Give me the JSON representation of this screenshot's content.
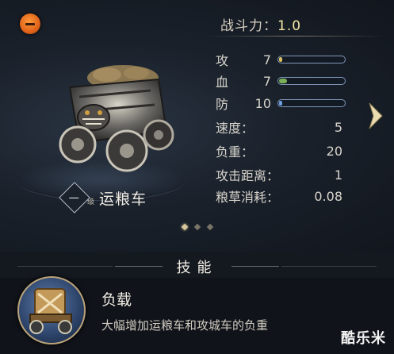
{
  "header": {
    "power_label": "战斗力：",
    "power_value": "1.0"
  },
  "unit": {
    "rank": "一",
    "level_tag": "级",
    "name": "运粮车"
  },
  "stats": [
    {
      "label": "攻",
      "value": "7",
      "bar_fraction": 0.03,
      "bar_color": "#d8c060"
    },
    {
      "label": "血",
      "value": "7",
      "bar_fraction": 0.12,
      "bar_color": "#7bb05a"
    },
    {
      "label": "防",
      "value": "10",
      "bar_fraction": 0.05,
      "bar_color": "#6aa0e0"
    }
  ],
  "attributes": [
    {
      "label": "速度：",
      "value": "5"
    },
    {
      "label": "负重：",
      "value": "20"
    },
    {
      "label": "攻击距离：",
      "value": "1"
    },
    {
      "label": "粮草消耗：",
      "value": "0.08"
    }
  ],
  "pager": {
    "count": 3,
    "active": 0
  },
  "skills": {
    "title": "技能",
    "items": [
      {
        "name": "负载",
        "description": "大幅增加运粮车和攻城车的负重"
      }
    ]
  },
  "watermark": "酷乐米",
  "colors": {
    "accent_gold": "#f2e6a6",
    "minus_button": "#e0631a",
    "bar_border": "#7e96b8"
  }
}
